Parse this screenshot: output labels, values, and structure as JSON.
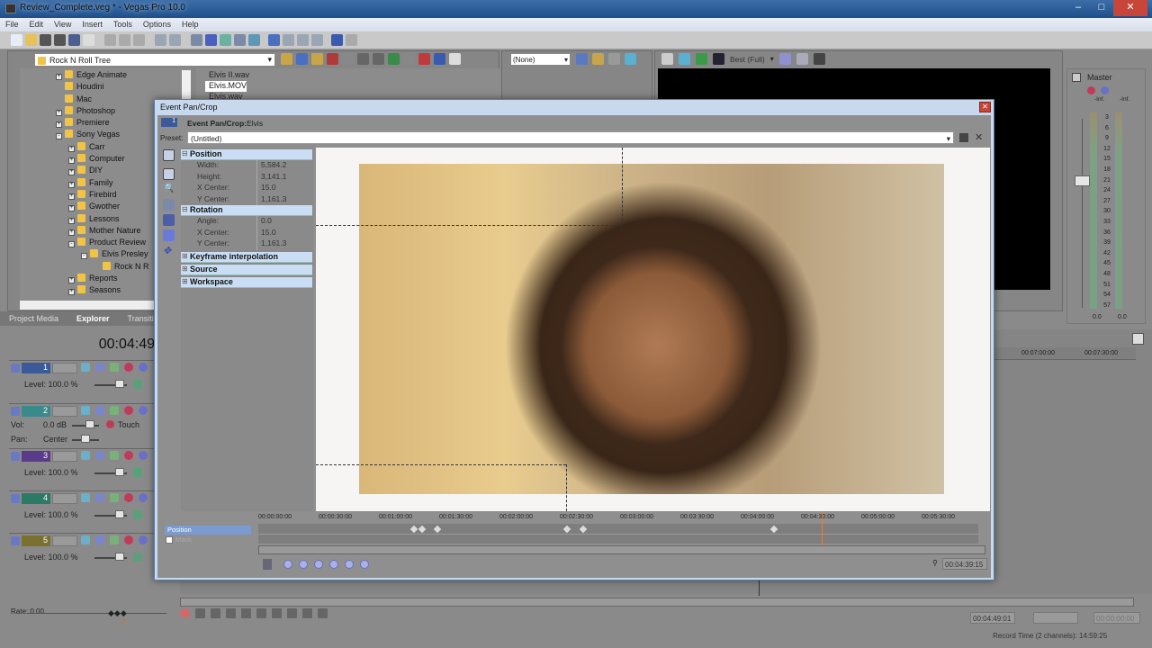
{
  "window": {
    "title": "Review_Complete.veg * - Vegas Pro 10.0"
  },
  "menu": [
    "File",
    "Edit",
    "View",
    "Insert",
    "Tools",
    "Options",
    "Help"
  ],
  "explorer": {
    "location": "Rock N Roll Tree",
    "tree": [
      {
        "label": "Edge Animate",
        "indent": 1,
        "expander": "+"
      },
      {
        "label": "Houdini",
        "indent": 1,
        "expander": ""
      },
      {
        "label": "Mac",
        "indent": 1,
        "expander": ""
      },
      {
        "label": "Photoshop",
        "indent": 1,
        "expander": "+"
      },
      {
        "label": "Premiere",
        "indent": 1,
        "expander": "+"
      },
      {
        "label": "Sony Vegas",
        "indent": 1,
        "expander": "-"
      },
      {
        "label": "Carr",
        "indent": 2,
        "expander": "+"
      },
      {
        "label": "Computer",
        "indent": 2,
        "expander": "+"
      },
      {
        "label": "DIY",
        "indent": 2,
        "expander": "+"
      },
      {
        "label": "Family",
        "indent": 2,
        "expander": "+"
      },
      {
        "label": "Firebird",
        "indent": 2,
        "expander": "+"
      },
      {
        "label": "Gwother",
        "indent": 2,
        "expander": "+"
      },
      {
        "label": "Lessons",
        "indent": 2,
        "expander": "+"
      },
      {
        "label": "Mother Nature",
        "indent": 2,
        "expander": "+"
      },
      {
        "label": "Product Review",
        "indent": 2,
        "expander": "-"
      },
      {
        "label": "Elvis Presley",
        "indent": 3,
        "expander": "-"
      },
      {
        "label": "Rock N R",
        "indent": 4,
        "expander": ""
      },
      {
        "label": "Reports",
        "indent": 2,
        "expander": "+"
      },
      {
        "label": "Seasons",
        "indent": 2,
        "expander": "+"
      }
    ],
    "files": [
      "Elvis II.wav",
      "Elvis.MOV",
      "Elvis.wav"
    ],
    "selected_file": "Elvis.MOV"
  },
  "tabs": [
    "Project Media",
    "Explorer",
    "Transiti"
  ],
  "active_tab": "Explorer",
  "timecode": "00:04:49",
  "tracks": [
    {
      "num": "1",
      "color": "#3b5a9a",
      "type": "video",
      "level": "Level: 100.0 %"
    },
    {
      "num": "2",
      "color": "#3a8a8c",
      "type": "audio",
      "vol_label": "Vol:",
      "vol": "0.0 dB",
      "pan_label": "Pan:",
      "pan": "Center",
      "mode": "Touch"
    },
    {
      "num": "3",
      "color": "#5a3b8a",
      "type": "video",
      "level": "Level: 100.0 %"
    },
    {
      "num": "4",
      "color": "#2a7a66",
      "type": "video",
      "level": "Level: 100.0 %"
    },
    {
      "num": "5",
      "color": "#7a7030",
      "type": "video",
      "level": "Level: 100.0 %"
    }
  ],
  "effects": {
    "preset": "(None)"
  },
  "preview": {
    "quality": "Best (Full)"
  },
  "mixer": {
    "title": "Master",
    "left_peak": "-Inf.",
    "right_peak": "-Inf.",
    "scale": [
      "3",
      "6",
      "9",
      "12",
      "15",
      "18",
      "21",
      "24",
      "27",
      "30",
      "33",
      "36",
      "39",
      "42",
      "45",
      "48",
      "51",
      "54",
      "57"
    ],
    "left_val": "0.0",
    "right_val": "0.0"
  },
  "timeline_ruler": [
    "00:07:00:00",
    "00:07:30:00"
  ],
  "dialog": {
    "title": "Event Pan/Crop",
    "header_label": "Event Pan/Crop:",
    "event_name": "Elvis",
    "track_num": "1",
    "preset_label": "Preset:",
    "preset": "(Untitled)",
    "sections": {
      "position": {
        "title": "Position",
        "rows": [
          [
            "Width:",
            "5,584.2"
          ],
          [
            "Height:",
            "3,141.1"
          ],
          [
            "X Center:",
            "15.0"
          ],
          [
            "Y Center:",
            "1,161.3"
          ]
        ]
      },
      "rotation": {
        "title": "Rotation",
        "rows": [
          [
            "Angle:",
            "0.0"
          ],
          [
            "X Center:",
            "15.0"
          ],
          [
            "Y Center:",
            "1,161.3"
          ]
        ]
      },
      "keyframe": "Keyframe interpolation",
      "source": "Source",
      "workspace": "Workspace"
    },
    "keyframe_tracks": [
      "Position",
      "Mask"
    ],
    "ruler": [
      "00:00:00:00",
      "00:00:30:00",
      "00:01:00:00",
      "00:01:30:00",
      "00:02:00:00",
      "00:02:30:00",
      "00:03:00:00",
      "00:03:30:00",
      "00:04:00:00",
      "00:04:30:00",
      "00:05:00:00",
      "00:05:30:00"
    ],
    "cursor_time": "00:04:39:15"
  },
  "transport": {
    "rate": "Rate: 0.00",
    "cursor": "00:04:49:01",
    "length": "00:00:00:00",
    "record_time": "Record Time (2 channels): 14:59:25"
  }
}
